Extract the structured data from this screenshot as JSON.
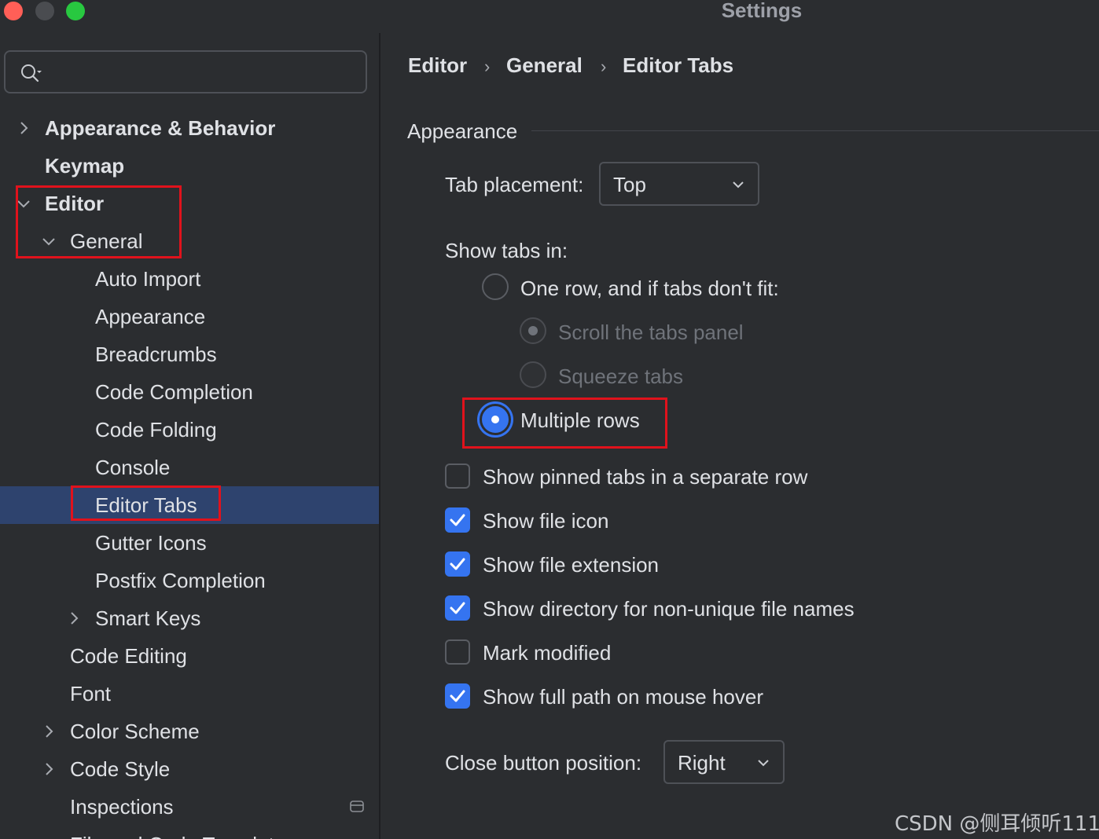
{
  "window": {
    "title": "Settings"
  },
  "search": {
    "placeholder": ""
  },
  "sidebar": {
    "items": [
      {
        "label": "Appearance & Behavior"
      },
      {
        "label": "Keymap"
      },
      {
        "label": "Editor"
      },
      {
        "label": "General"
      },
      {
        "label": "Auto Import"
      },
      {
        "label": "Appearance"
      },
      {
        "label": "Breadcrumbs"
      },
      {
        "label": "Code Completion"
      },
      {
        "label": "Code Folding"
      },
      {
        "label": "Console"
      },
      {
        "label": "Editor Tabs"
      },
      {
        "label": "Gutter Icons"
      },
      {
        "label": "Postfix Completion"
      },
      {
        "label": "Smart Keys"
      },
      {
        "label": "Code Editing"
      },
      {
        "label": "Font"
      },
      {
        "label": "Color Scheme"
      },
      {
        "label": "Code Style"
      },
      {
        "label": "Inspections"
      },
      {
        "label": "File and Code Templates"
      }
    ]
  },
  "breadcrumb": [
    "Editor",
    "General",
    "Editor Tabs"
  ],
  "breadcrumb_separator": "›",
  "main": {
    "section_title": "Appearance",
    "tab_placement": {
      "label": "Tab placement:",
      "value": "Top"
    },
    "show_tabs_in": {
      "label": "Show tabs in:",
      "options": [
        {
          "label": "One row, and if tabs don't fit:",
          "selected": false
        },
        {
          "label": "Scroll the tabs panel",
          "selected": true,
          "enabled": false
        },
        {
          "label": "Squeeze tabs",
          "selected": false,
          "enabled": false
        },
        {
          "label": "Multiple rows",
          "selected": true
        }
      ]
    },
    "checkboxes": [
      {
        "label": "Show pinned tabs in a separate row",
        "checked": false
      },
      {
        "label": "Show file icon",
        "checked": true
      },
      {
        "label": "Show file extension",
        "checked": true
      },
      {
        "label": "Show directory for non-unique file names",
        "checked": true
      },
      {
        "label": "Mark modified",
        "checked": false
      },
      {
        "label": "Show full path on mouse hover",
        "checked": true
      }
    ],
    "close_button_position": {
      "label": "Close button position:",
      "value": "Right"
    }
  },
  "watermark": "CSDN @侧耳倾听111",
  "colors": {
    "accent": "#3574f0",
    "selection": "#2e436e",
    "highlight_box": "#e0121c"
  }
}
